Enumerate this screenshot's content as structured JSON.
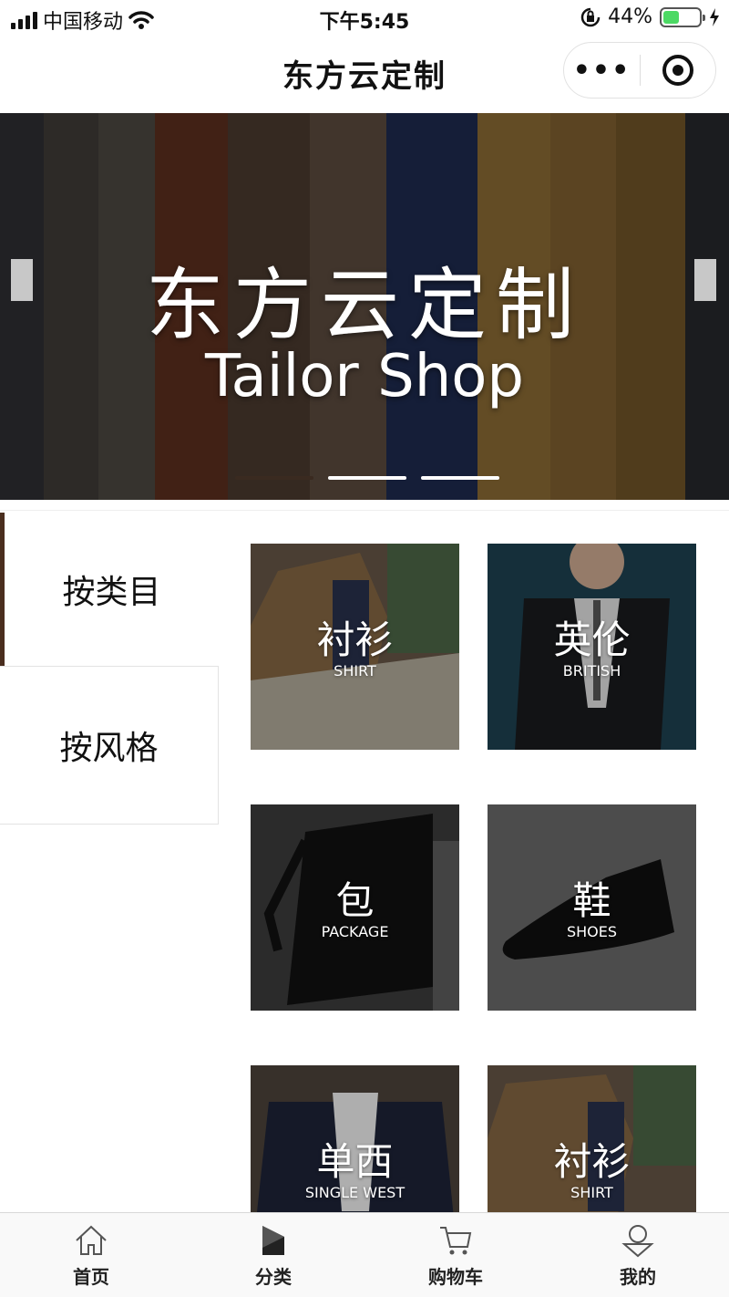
{
  "status_bar": {
    "carrier": "中国移动",
    "time": "下午5:45",
    "battery_percent_text": "44%",
    "battery_level": 0.44
  },
  "nav_bar": {
    "title": "东方云定制",
    "more_label": "•••"
  },
  "banner": {
    "title": "东方云定制",
    "subtitle": "Tailor Shop",
    "slide_count": 3,
    "active_slide": 1
  },
  "category_tabs": [
    {
      "label": "按类目",
      "active": true
    },
    {
      "label": "按风格",
      "active": false
    }
  ],
  "products": [
    {
      "cn": "衬衫",
      "en": "SHIRT"
    },
    {
      "cn": "英伦",
      "en": "BRITISH"
    },
    {
      "cn": "包",
      "en": "PACKAGE"
    },
    {
      "cn": "鞋",
      "en": "SHOES"
    },
    {
      "cn": "单西",
      "en": "SINGLE WEST"
    },
    {
      "cn": "衬衫",
      "en": "SHIRT"
    }
  ],
  "tab_bar": [
    {
      "label": "首页",
      "icon": "home-icon"
    },
    {
      "label": "分类",
      "icon": "category-icon"
    },
    {
      "label": "购物车",
      "icon": "cart-icon"
    },
    {
      "label": "我的",
      "icon": "profile-icon"
    }
  ],
  "colors": {
    "accent": "#4a2e1e",
    "battery_fill": "#4cd964"
  }
}
